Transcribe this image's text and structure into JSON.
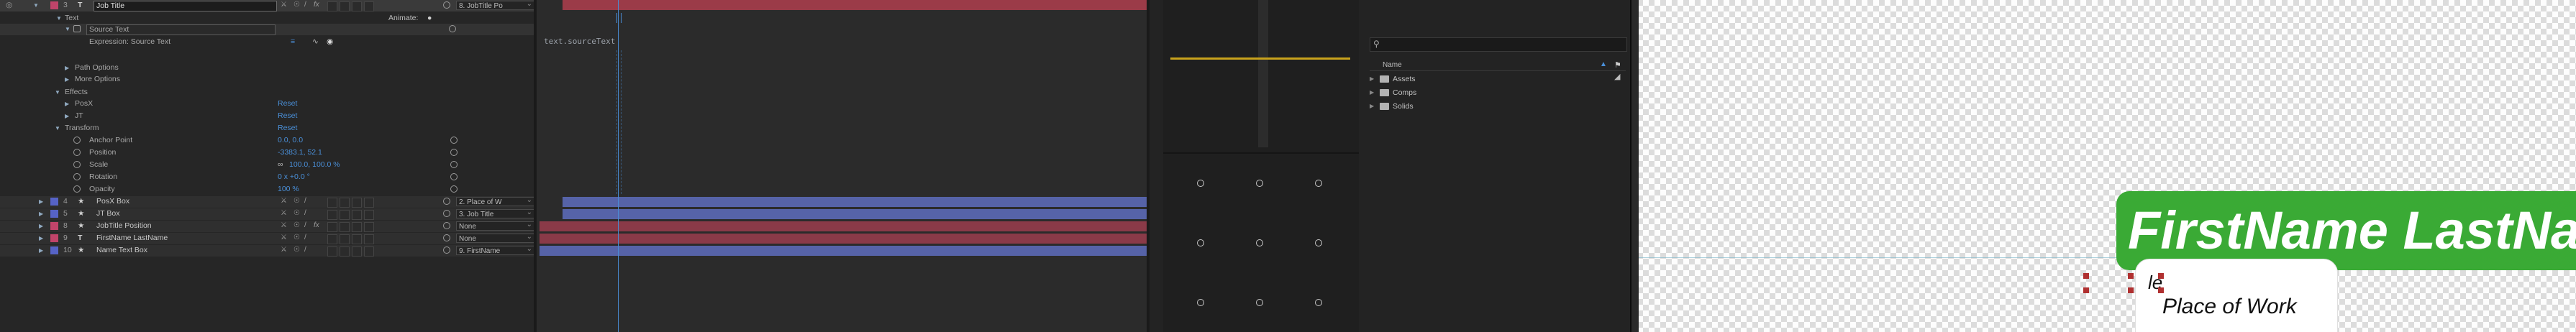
{
  "timeline": {
    "animate_label": "Animate:",
    "selected_layer": {
      "number": "3",
      "name": "Job Title",
      "parent": "8. JobTitle Po"
    },
    "properties": [
      {
        "id": "text",
        "label": "Text"
      },
      {
        "id": "source_text",
        "label": "Source Text"
      },
      {
        "id": "expression",
        "label": "Expression: Source Text"
      },
      {
        "id": "path_options",
        "label": "Path Options"
      },
      {
        "id": "more_options",
        "label": "More Options"
      },
      {
        "id": "effects",
        "label": "Effects"
      },
      {
        "id": "fx_pos",
        "label": "PosX",
        "value": "Reset"
      },
      {
        "id": "fx_jt",
        "label": "JT",
        "value": "Reset"
      },
      {
        "id": "transform",
        "label": "Transform",
        "value": "Reset"
      },
      {
        "id": "anchor",
        "label": "Anchor Point",
        "value": "0.0, 0.0"
      },
      {
        "id": "position",
        "label": "Position",
        "value": "-3383.1, 52.1"
      },
      {
        "id": "scale",
        "label": "Scale",
        "value": "100.0, 100.0 %"
      },
      {
        "id": "rotation",
        "label": "Rotation",
        "value": "0 x +0.0 °"
      },
      {
        "id": "opacity",
        "label": "Opacity",
        "value": "100 %"
      }
    ],
    "layers": [
      {
        "number": "4",
        "name": "PosX Box",
        "parent": "2. Place of W",
        "color": "#5663c6"
      },
      {
        "number": "5",
        "name": "JT Box",
        "parent": "3. Job Title",
        "color": "#5663c6"
      },
      {
        "number": "8",
        "name": "JobTitle Position",
        "parent": "None",
        "color": "#c0446a"
      },
      {
        "number": "9",
        "name": "FirstName LastName",
        "parent": "None",
        "color": "#c0446a"
      },
      {
        "number": "10",
        "name": "Name Text Box",
        "parent": "9. FirstName",
        "color": "#5663c6"
      }
    ],
    "expression_text": "text.sourceText"
  },
  "project": {
    "search_placeholder": "",
    "column_name": "Name",
    "items": [
      {
        "label": "Assets"
      },
      {
        "label": "Comps"
      },
      {
        "label": "Solids"
      }
    ]
  },
  "viewer": {
    "name_text": "FirstName LastNar",
    "place_text": "Place of Work",
    "partial_text": "le",
    "name_bar_color": "#3aaa35"
  },
  "colors": {
    "accent_blue": "#4a8fd8",
    "bar_red": "#9b3b48",
    "bar_blue": "#5663a8"
  }
}
